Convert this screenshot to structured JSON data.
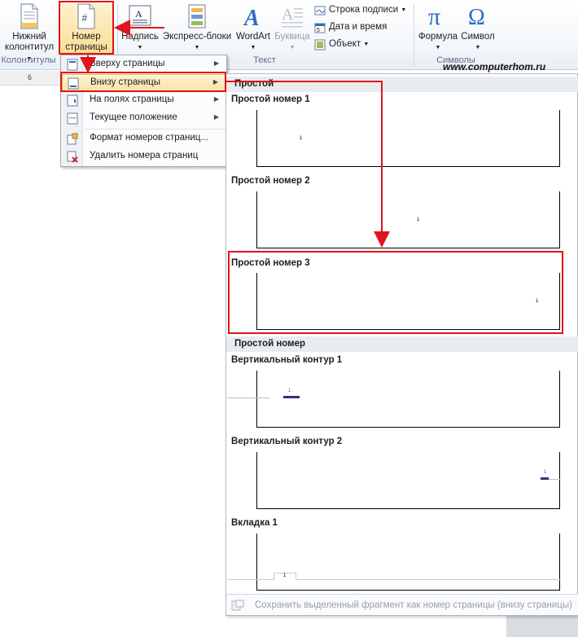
{
  "ribbon": {
    "footer_btn": {
      "line1": "Нижний",
      "line2": "колонтитул"
    },
    "page_number_btn": {
      "line1": "Номер",
      "line2": "страницы"
    },
    "textbox_btn": "Надпись",
    "quickparts_btn": "Экспресс-блоки",
    "wordart_btn": "WordArt",
    "dropcap_btn": "Буквица",
    "signature_line": "Строка подписи",
    "date_time": "Дата и время",
    "object": "Объект",
    "formula_btn": "Формула",
    "symbol_btn": "Символ",
    "groups": {
      "headers": "Колонтитулы",
      "text": "Текст",
      "symbols": "Символы"
    },
    "ruler_mark": "6"
  },
  "watermark": "www.computerhom.ru",
  "menu": {
    "items": [
      {
        "label": "Вверху страницы"
      },
      {
        "label": "Внизу страницы"
      },
      {
        "label": "На полях страницы"
      },
      {
        "label": "Текущее положение"
      },
      {
        "label": "Формат номеров страниц..."
      },
      {
        "label": "Удалить номера страниц"
      }
    ]
  },
  "gallery": {
    "header1": "Простой",
    "header2": "Простой номер",
    "items": [
      {
        "title": "Простой номер 1",
        "number": "1"
      },
      {
        "title": "Простой номер 2",
        "number": "1"
      },
      {
        "title": "Простой номер 3",
        "number": "1"
      },
      {
        "title": "Вертикальный контур 1",
        "number": "1"
      },
      {
        "title": "Вертикальный контур 2",
        "number": "1"
      },
      {
        "title": "Вкладка 1",
        "number": "1"
      }
    ],
    "footer": "Сохранить выделенный фрагмент как номер страницы (внизу страницы)"
  },
  "colors": {
    "accent_red": "#e0141c",
    "highlight": "#fbe3a6",
    "purple_bar": "#3c2f7a"
  }
}
